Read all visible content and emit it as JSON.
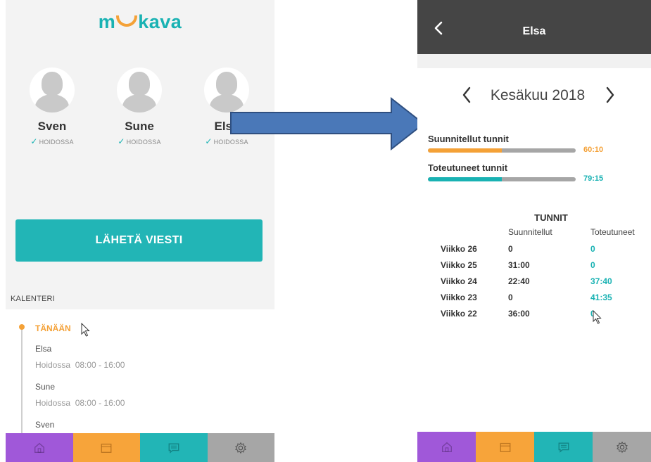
{
  "left_screen": {
    "logo": {
      "part1": "m",
      "part2": "kava"
    },
    "children": [
      {
        "name": "Sven",
        "status": "HOIDOSSA"
      },
      {
        "name": "Sune",
        "status": "HOIDOSSA"
      },
      {
        "name": "Elsa",
        "status": "HOIDOSSA"
      }
    ],
    "send_button": "LÄHETÄ VIESTI",
    "calendar": {
      "title": "KALENTERI",
      "today_label": "TÄNÄÄN",
      "entries": [
        {
          "name": "Elsa",
          "status": "Hoidossa",
          "time": "08:00 - 16:00"
        },
        {
          "name": "Sune",
          "status": "Hoidossa",
          "time": "08:00 - 16:00"
        },
        {
          "name": "Sven"
        }
      ]
    },
    "tabbar": [
      {
        "icon": "home-icon",
        "color": "#a058d9"
      },
      {
        "icon": "calendar-icon",
        "color": "#f7a43a"
      },
      {
        "icon": "message-icon",
        "color": "#22b5b6"
      },
      {
        "icon": "gear-icon",
        "color": "#a6a6a6"
      }
    ]
  },
  "right_screen": {
    "title": "Elsa",
    "month": "Kesäkuu 2018",
    "planned": {
      "label": "Suunnitellut tunnit",
      "value": "60:10",
      "fill_fraction": 0.5,
      "color": "#f4a137"
    },
    "actual": {
      "label": "Toteutuneet tunnit",
      "value": "79:15",
      "fill_fraction": 0.5,
      "color": "#19b2b3"
    },
    "table": {
      "title": "TUNNIT",
      "columns": [
        "Suunnitellut",
        "Toteutuneet"
      ],
      "rows": [
        {
          "week": "Viikko 26",
          "planned": "0",
          "actual": "0"
        },
        {
          "week": "Viikko 25",
          "planned": "31:00",
          "actual": "0"
        },
        {
          "week": "Viikko 24",
          "planned": "22:40",
          "actual": "37:40"
        },
        {
          "week": "Viikko 23",
          "planned": "0",
          "actual": "41:35"
        },
        {
          "week": "Viikko 22",
          "planned": "36:00",
          "actual": "0"
        }
      ]
    },
    "tabbar": [
      {
        "icon": "home-icon",
        "color": "#a058d9"
      },
      {
        "icon": "calendar-icon",
        "color": "#f7a43a"
      },
      {
        "icon": "message-icon",
        "color": "#22b5b6"
      },
      {
        "icon": "gear-icon",
        "color": "#a6a6a6"
      }
    ]
  },
  "colors": {
    "accent": "#19b2b3",
    "orange": "#f4a137",
    "arrow": "#4a78b8"
  }
}
